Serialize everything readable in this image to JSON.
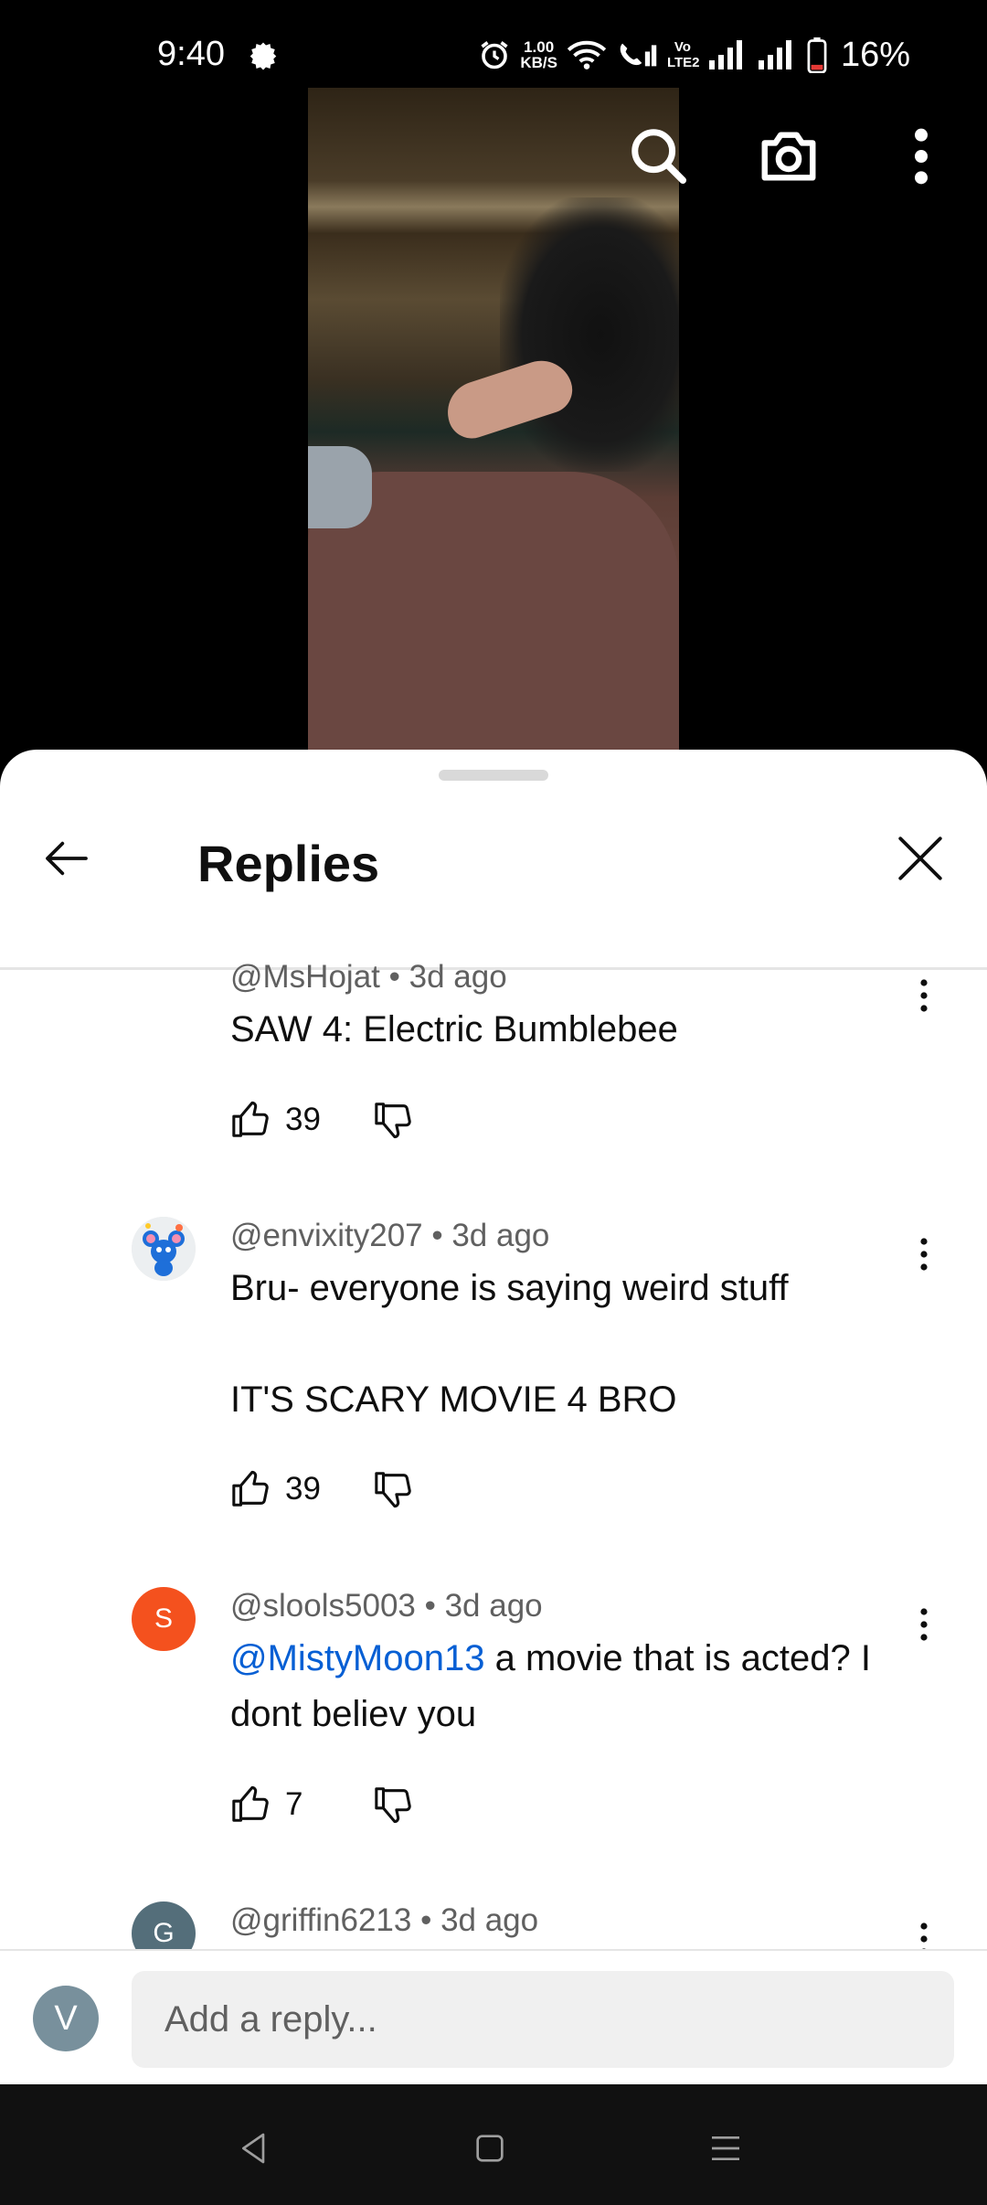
{
  "status_bar": {
    "time": "9:40",
    "net_speed_value": "1.00",
    "net_speed_unit": "KB/S",
    "volte_label": "Vo LTE2",
    "battery_percent": "16%"
  },
  "video_controls": {
    "icons": [
      "search-icon",
      "camera-icon",
      "more-vert-icon"
    ]
  },
  "sheet": {
    "title": "Replies"
  },
  "comments": [
    {
      "author": "@MsHojat",
      "time": "3d ago",
      "text": "SAW 4: Electric Bumblebee",
      "likes": "39",
      "avatar": ""
    },
    {
      "author": "@envixity207",
      "time": "3d ago",
      "text": "Bru- everyone is saying weird stuff\n\nIT'S SCARY MOVIE 4 BRO",
      "likes": "39",
      "avatar": "mouse-avatar"
    },
    {
      "author": "@slools5003",
      "time": "3d ago",
      "mention": "@MistyMoon13",
      "text": " a movie that is acted? I dont believ you",
      "likes": "7",
      "avatar_letter": "S",
      "avatar_color": "#f4511e"
    },
    {
      "author": "@griffin6213",
      "time": "3d ago",
      "avatar_letter": "G",
      "avatar_color": "#546e7a"
    }
  ],
  "reply_bar": {
    "user_initial": "V",
    "placeholder": "Add a reply..."
  },
  "separator": " • ",
  "colors": {
    "link": "#065fd4",
    "meta": "#606060",
    "sheet_bg": "#ffffff",
    "nav_bg": "#111111"
  }
}
